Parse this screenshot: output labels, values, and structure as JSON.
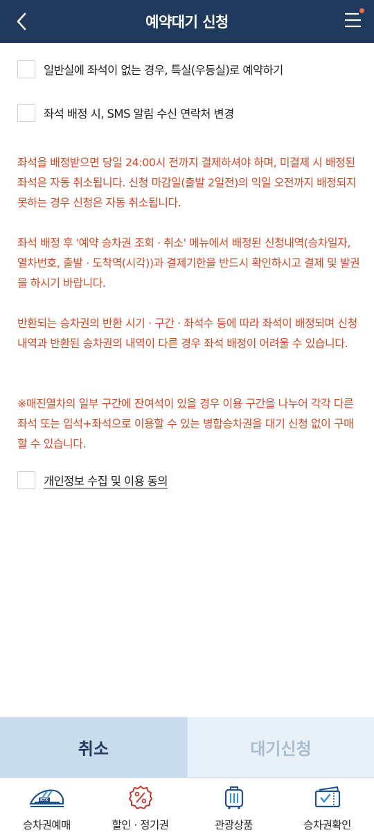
{
  "header": {
    "title": "예약대기 신청",
    "back_icon": "chevron-left-icon",
    "menu_icon": "hamburger-menu-icon",
    "notification_color": "#f26a4b",
    "background": "#1f3a5c"
  },
  "options": [
    {
      "label": "일반실에 좌석이 없는 경우, 특실(우등실)로 예약하기",
      "checked": false
    },
    {
      "label": "좌석 배정 시, SMS 알림 수신 연락처 변경",
      "checked": false
    }
  ],
  "notices": [
    "좌석을 배정받으면 당일 24:00시 전까지 결제하셔야 하며, 미결제 시 배정된 좌석은 자동 취소됩니다. 신청 마감일(출발 2일전)의 익일 오전까지 배정되지 못하는 경우 신청은 자동 취소됩니다.",
    "좌석 배정 후 '예약 승차권 조회 · 취소' 메뉴에서 배정된 신청내역(승차일자, 열차번호, 출발 · 도착역(시각))과 결제기한을 반드시 확인하시고 결제 및 발권을 하시기 바랍니다.",
    "반환되는 승차권의 반환 시기 · 구간 · 좌석수 등에 따라 좌석이 배정되며 신청내역과 반환된 승차권의 내역이 다른 경우 좌석 배정이 어려울 수 있습니다.",
    "※매진열차의 일부 구간에 잔여석이 있을 경우 이용 구간을 나누어 각각 다른 좌석 또는 입석+좌석으로 이용할 수 있는 병합승차권을 대기 신청 없이 구매할 수 있습니다."
  ],
  "notice_color": "#d64a27",
  "consent": {
    "label": "개인정보 수집 및 이용 동의",
    "checked": false
  },
  "buttons": {
    "cancel_label": "취소",
    "submit_label": "대기신청"
  },
  "tabs": [
    {
      "label": "승차권예매",
      "icon": "ktx-train-icon"
    },
    {
      "label": "할인 · 정기권",
      "icon": "discount-badge-icon"
    },
    {
      "label": "관광상품",
      "icon": "luggage-icon"
    },
    {
      "label": "승차권확인",
      "icon": "ticket-check-icon"
    }
  ]
}
